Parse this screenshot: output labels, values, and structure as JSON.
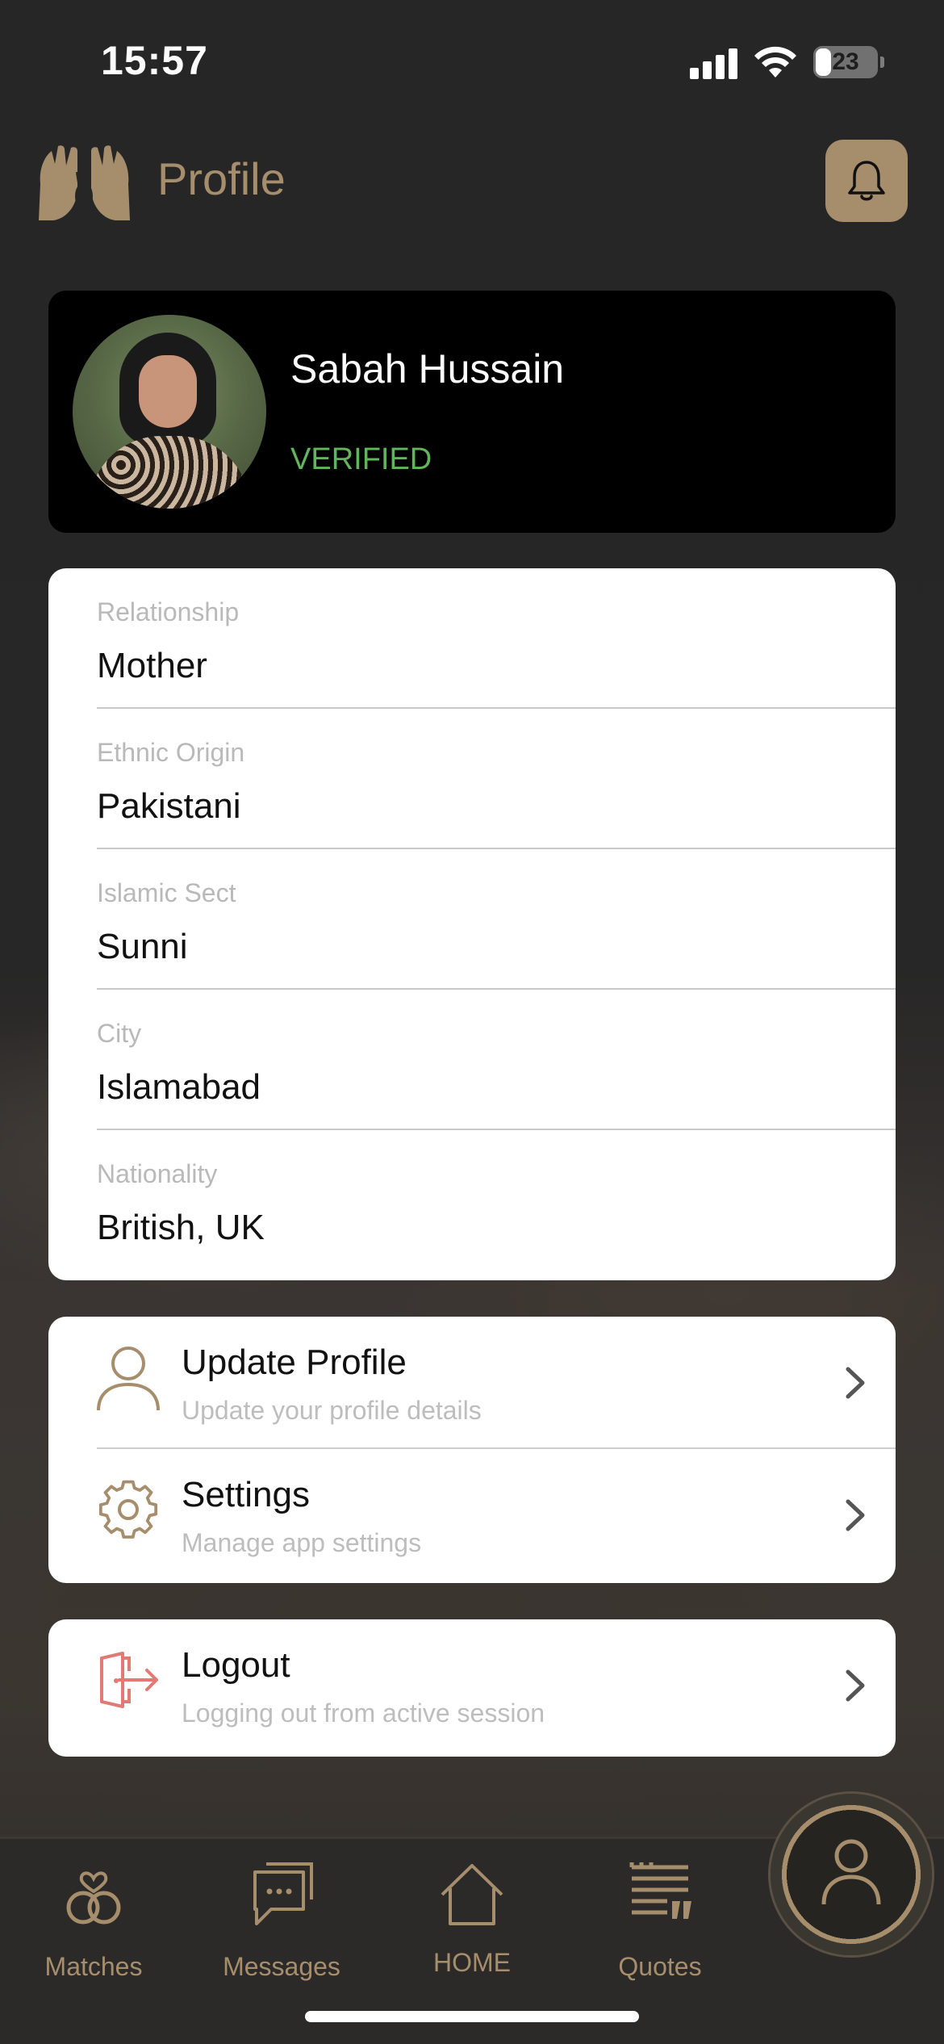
{
  "status_bar": {
    "time": "15:57",
    "battery": "23"
  },
  "header": {
    "title": "Profile"
  },
  "profile": {
    "name": "Sabah Hussain",
    "status": "VERIFIED"
  },
  "details": [
    {
      "label": "Relationship",
      "value": "Mother"
    },
    {
      "label": "Ethnic Origin",
      "value": "Pakistani"
    },
    {
      "label": "Islamic Sect",
      "value": "Sunni"
    },
    {
      "label": "City",
      "value": "Islamabad"
    },
    {
      "label": "Nationality",
      "value": "British, UK"
    }
  ],
  "menu": {
    "update_profile": {
      "title": "Update Profile",
      "subtitle": "Update your profile details",
      "icon": "user-icon"
    },
    "settings": {
      "title": "Settings",
      "subtitle": "Manage app settings",
      "icon": "gear-icon"
    },
    "logout": {
      "title": "Logout",
      "subtitle": "Logging out from active session",
      "icon": "logout-icon"
    }
  },
  "tabs": [
    {
      "label": "Matches",
      "icon": "rings-heart-icon"
    },
    {
      "label": "Messages",
      "icon": "chat-icon"
    },
    {
      "label": "HOME",
      "icon": "home-icon"
    },
    {
      "label": "Quotes",
      "icon": "quote-icon"
    }
  ],
  "colors": {
    "accent": "#a68e6c",
    "verified": "#62b55d",
    "logout": "#e07a73",
    "background": "#262626"
  }
}
